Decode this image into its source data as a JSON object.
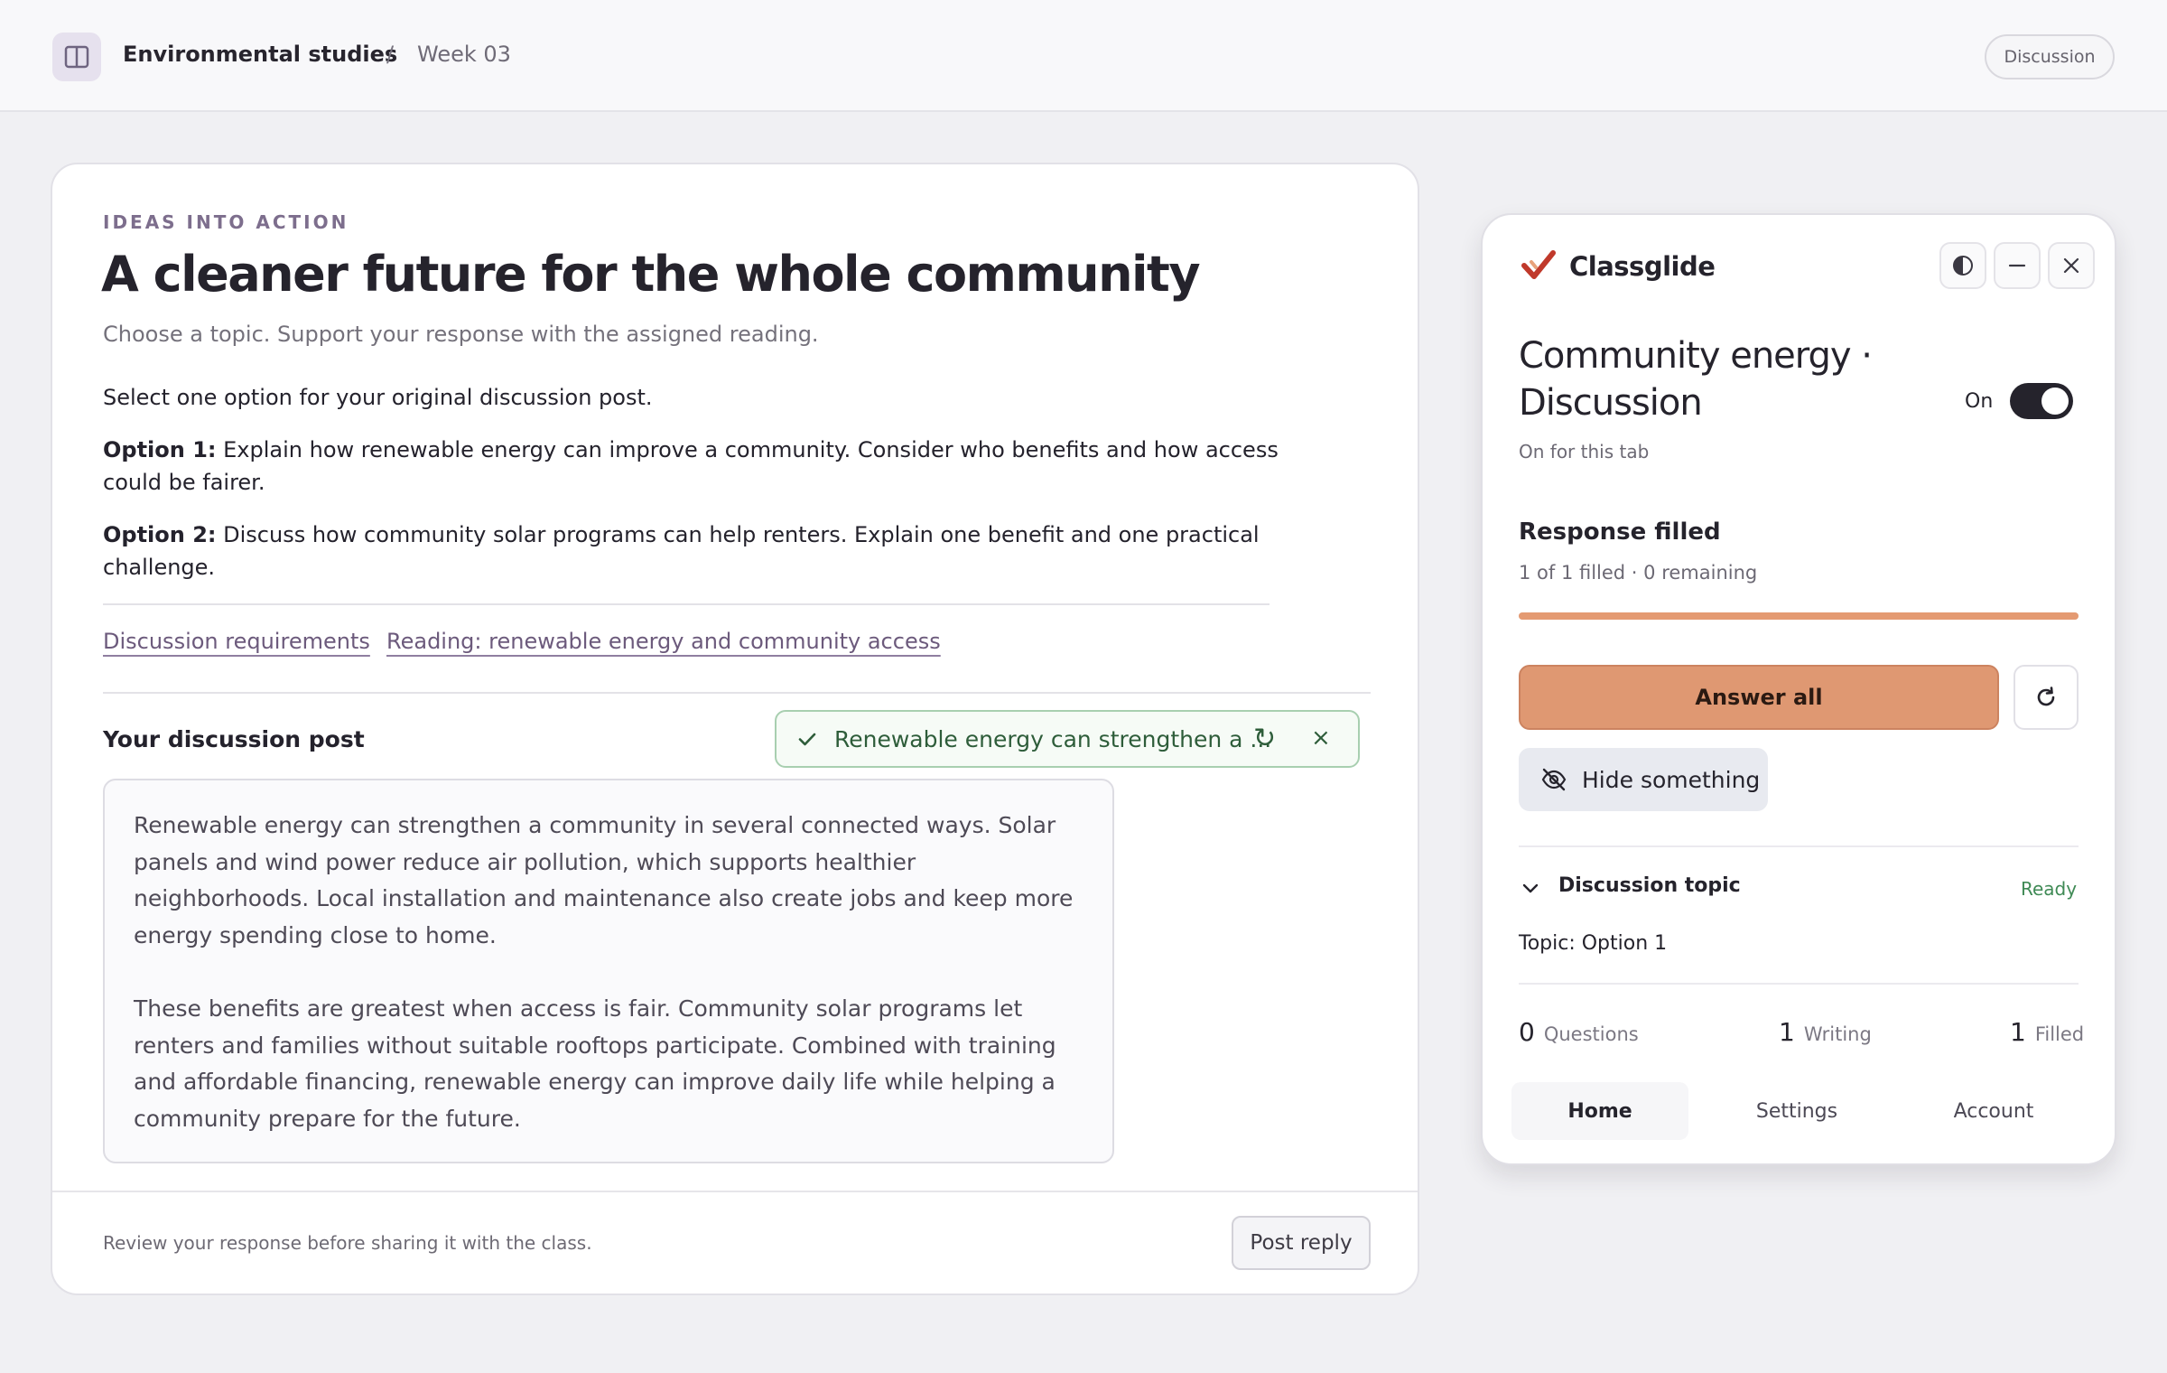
{
  "topbar": {
    "course": "Environmental studies",
    "separator": "/",
    "week": "Week 03",
    "badge": "Discussion"
  },
  "assignment": {
    "eyebrow": "IDEAS INTO ACTION",
    "title": "A cleaner future for the whole community",
    "subtitle": "Choose a topic. Support your response with the assigned reading.",
    "intro": "Select one option for your original discussion post.",
    "options": [
      {
        "label": "Option 1:",
        "text": " Explain how renewable energy can improve a community. Consider who benefits and how access could be fairer."
      },
      {
        "label": "Option 2:",
        "text": " Discuss how community solar programs can help renters. Explain one benefit and one practical challenge."
      }
    ],
    "links": [
      "Discussion requirements",
      "Reading: renewable energy and community access"
    ],
    "post_label": "Your discussion post",
    "toast_text": "Renewable energy can strengthen a ...",
    "post_paragraphs": [
      "Renewable energy can strengthen a community in several connected ways. Solar panels and wind power reduce air pollution, which supports healthier neighborhoods. Local installation and maintenance also create jobs and keep more energy spending close to home.",
      "These benefits are greatest when access is fair. Community solar programs let renters and families without suitable rooftops participate. Combined with training and affordable financing, renewable energy can improve daily life while helping a community prepare for the future."
    ],
    "footer_note": "Review your response before sharing it with the class.",
    "post_button": "Post reply"
  },
  "panel": {
    "brand": "Classglide",
    "title": "Community energy · Discussion",
    "toggle_label": "On",
    "toggle_on": true,
    "scope": "On for this tab",
    "response_title": "Response filled",
    "response_sub": "1 of 1 filled · 0 remaining",
    "progress": 1.0,
    "answer_all": "Answer all",
    "hide_something": "Hide something",
    "topic_heading": "Discussion topic",
    "topic_status": "Ready",
    "topic_value": "Topic: Option 1",
    "stats": [
      {
        "n": "0",
        "label": "Questions"
      },
      {
        "n": "1",
        "label": "Writing"
      },
      {
        "n": "1",
        "label": "Filled"
      }
    ],
    "tabs": [
      "Home",
      "Settings",
      "Account"
    ],
    "colors": {
      "accent": "#df9872",
      "ready": "#3f8a55",
      "brand_mark": "#c0392b"
    }
  }
}
